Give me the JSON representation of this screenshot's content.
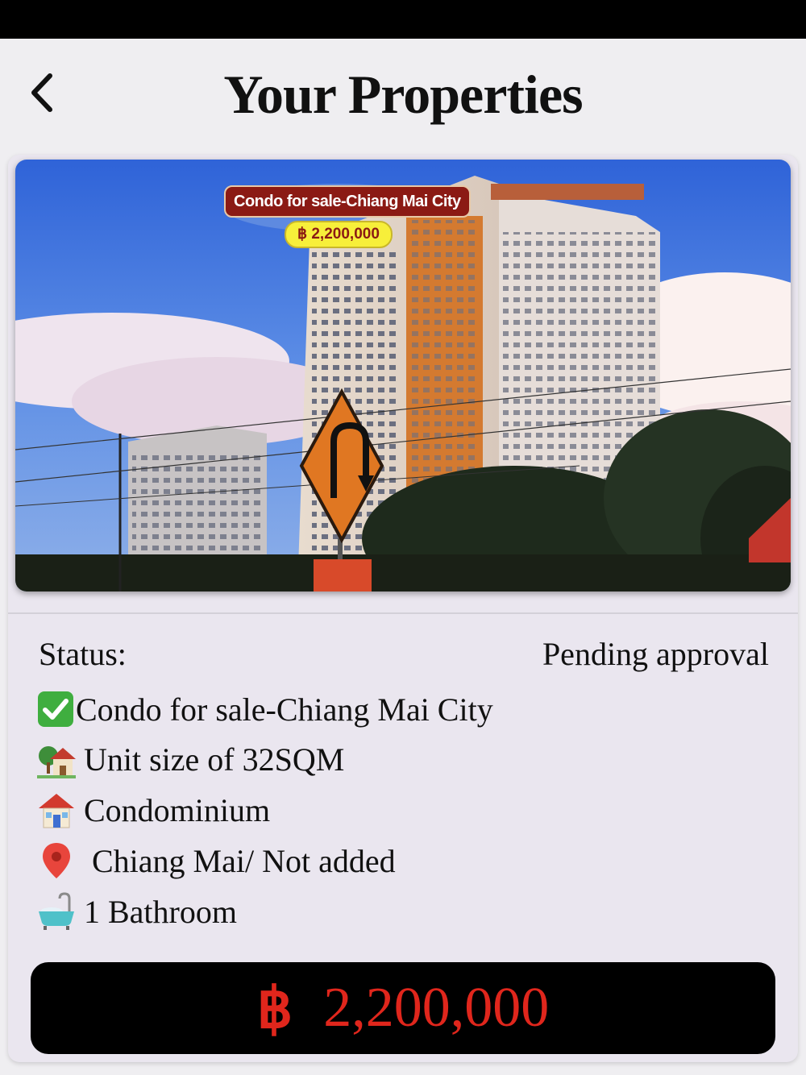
{
  "header": {
    "title": "Your Properties"
  },
  "property": {
    "image_overlay_title": "Condo for sale-Chiang Mai City",
    "image_overlay_price": "฿ 2,200,000",
    "status_label": "Status:",
    "status_value": "Pending approval",
    "details": [
      {
        "icon": "check-icon",
        "text": "Condo for sale-Chiang Mai City"
      },
      {
        "icon": "house-garden-icon",
        "text": "Unit size of 32SQM"
      },
      {
        "icon": "house-icon",
        "text": "Condominium"
      },
      {
        "icon": "location-pin-icon",
        "text": "Chiang Mai/ Not added"
      },
      {
        "icon": "bathtub-icon",
        "text": "1 Bathroom"
      }
    ],
    "price_symbol": "฿",
    "price": "2,200,000"
  },
  "colors": {
    "price_text": "#e0261c",
    "price_bg": "#000000",
    "overlay_title_bg": "#8b1a14",
    "overlay_price_bg": "#f7ef3a"
  }
}
